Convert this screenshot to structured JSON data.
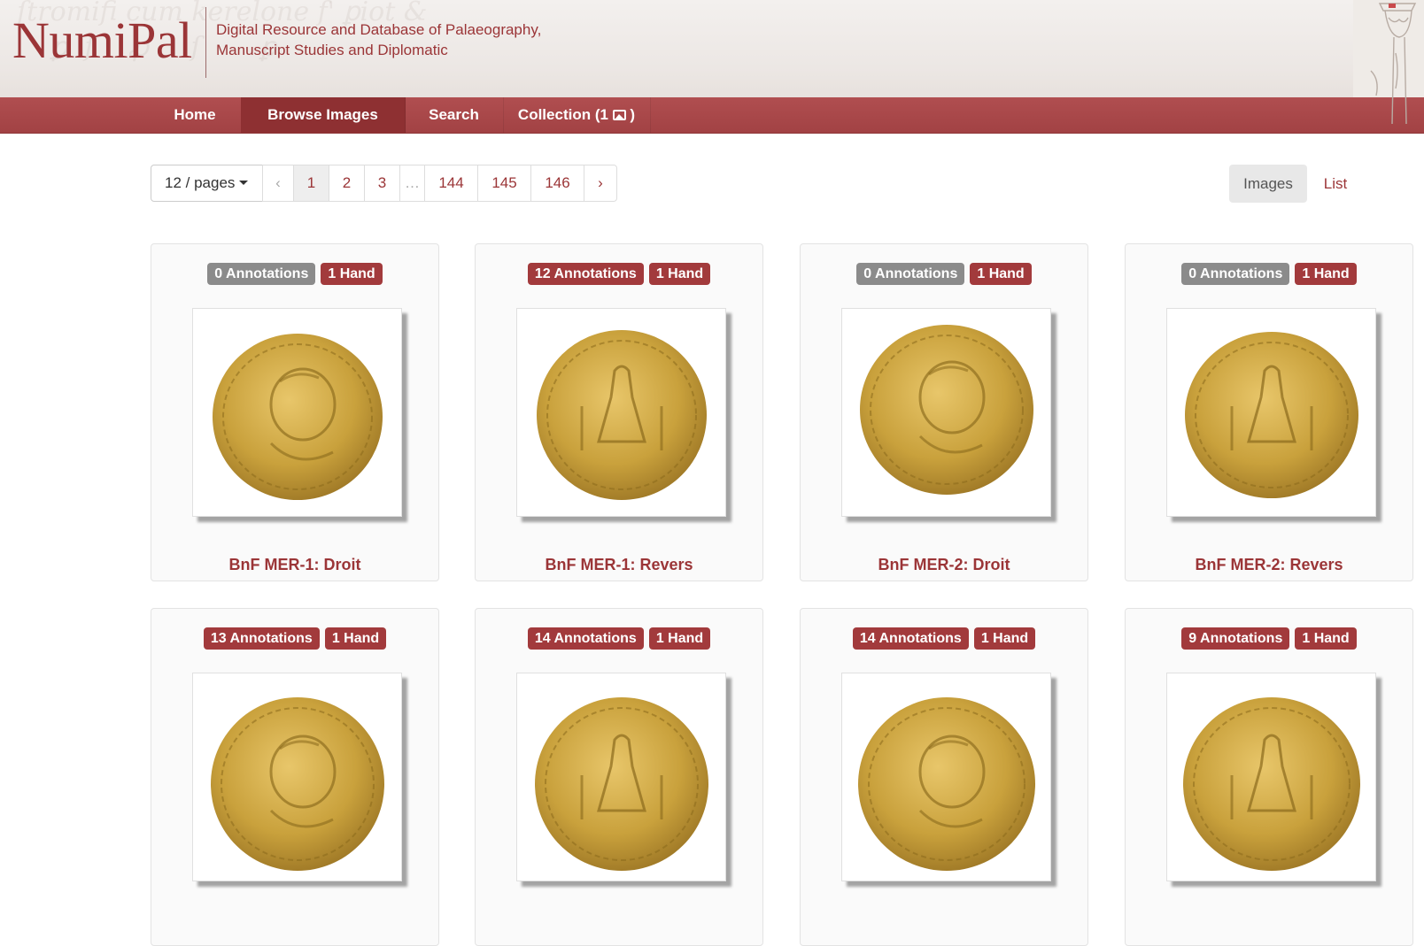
{
  "header": {
    "logo": "NumiPal",
    "tagline_line1": "Digital Resource and Database of Palaeography,",
    "tagline_line2": "Manuscript Studies and Diplomatic"
  },
  "nav": {
    "home": "Home",
    "browse": "Browse Images",
    "search": "Search",
    "collection_prefix": "Collection (1",
    "collection_suffix": ")",
    "collection_icon": "image-icon"
  },
  "toolbar": {
    "per_page": "12 / pages",
    "prev": "‹",
    "next": "›",
    "ellipsis": "…",
    "pages": [
      "1",
      "2",
      "3",
      "144",
      "145",
      "146"
    ],
    "current_page": "1",
    "view_images": "Images",
    "view_list": "List"
  },
  "colors": {
    "brand": "#9b3537",
    "nav_bar": "#a84648",
    "badge_gray": "#8b8b8b",
    "badge_red": "#a23a3c",
    "coin_gold": "#c9a13c"
  },
  "cards": [
    {
      "annotations": "0 Annotations",
      "hands": "1 Hand",
      "title": "BnF MER-1: Droit",
      "annotated": false
    },
    {
      "annotations": "12 Annotations",
      "hands": "1 Hand",
      "title": "BnF MER-1: Revers",
      "annotated": true
    },
    {
      "annotations": "0 Annotations",
      "hands": "1 Hand",
      "title": "BnF MER-2: Droit",
      "annotated": false
    },
    {
      "annotations": "0 Annotations",
      "hands": "1 Hand",
      "title": "BnF MER-2: Revers",
      "annotated": false
    },
    {
      "annotations": "13 Annotations",
      "hands": "1 Hand",
      "title": "",
      "annotated": true
    },
    {
      "annotations": "14 Annotations",
      "hands": "1 Hand",
      "title": "",
      "annotated": true
    },
    {
      "annotations": "14 Annotations",
      "hands": "1 Hand",
      "title": "",
      "annotated": true
    },
    {
      "annotations": "9 Annotations",
      "hands": "1 Hand",
      "title": "",
      "annotated": true
    }
  ]
}
